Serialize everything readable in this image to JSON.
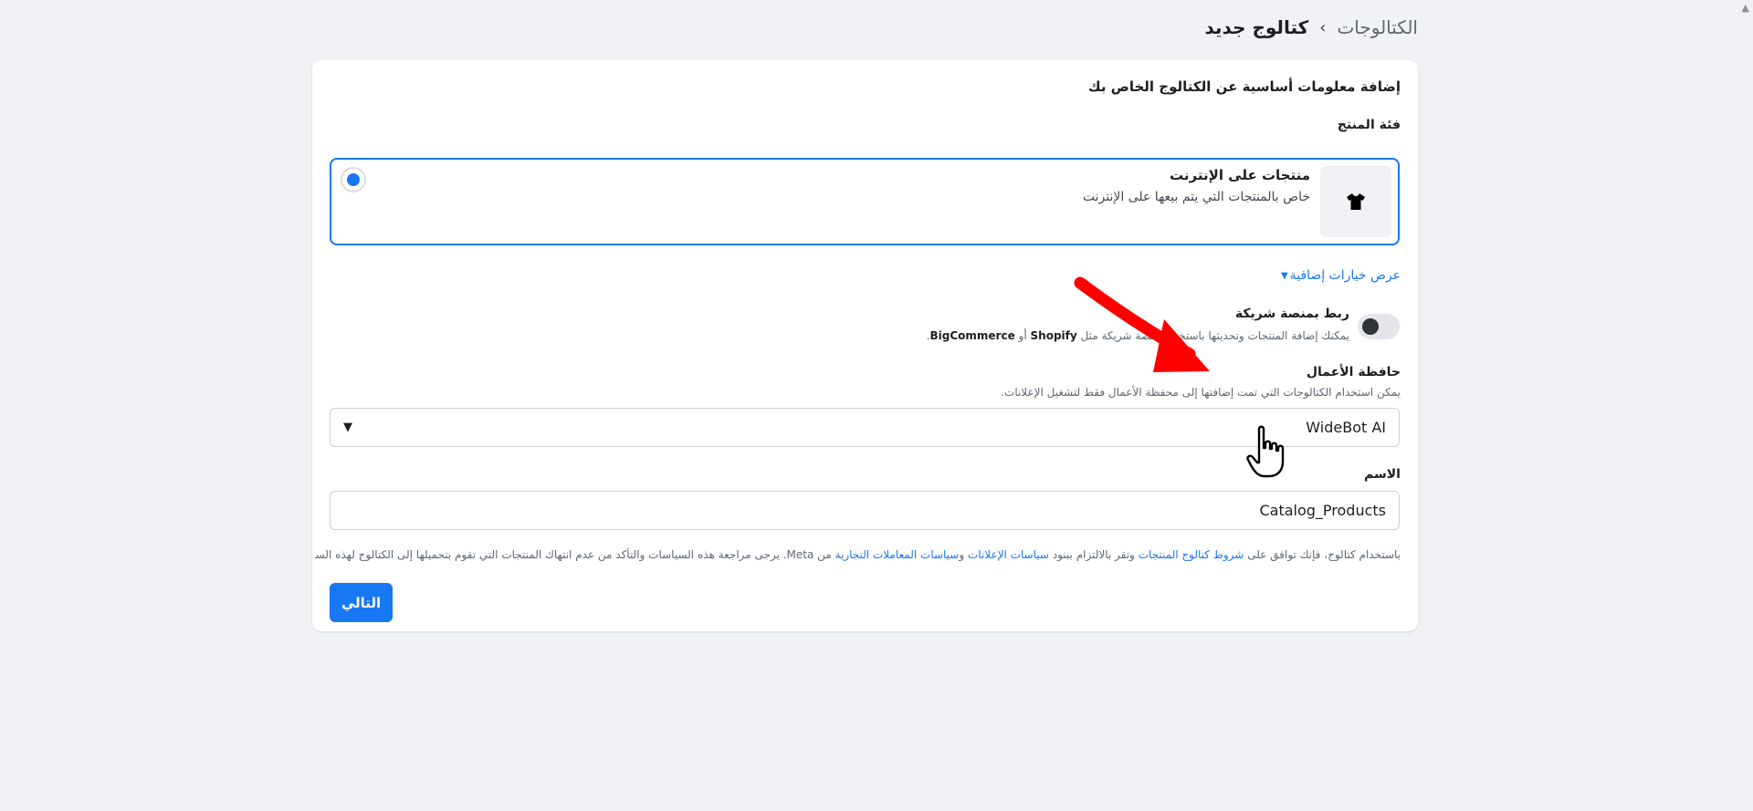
{
  "breadcrumb": {
    "parent": "الكتالوجات",
    "separator": "›",
    "current": "كتالوج جديد"
  },
  "card": {
    "title": "إضافة معلومات أساسية عن الكتالوج الخاص بك",
    "product_category_label": "فئة المنتج",
    "option": {
      "icon": "tshirt-icon",
      "title": "منتجات على الإنترنت",
      "description": "خاص بالمنتجات التي يتم بيعها على الإنترنت",
      "selected": true
    },
    "more_options_label": "عرض خيارات إضافية",
    "partner": {
      "title": "ربط بمنصة شريكة",
      "description_prefix": "يمكنك إضافة المنتجات وتحديثها باستخدام منصة شريكة مثل",
      "shopify": "Shopify",
      "or": "أو",
      "bigcommerce": "BigCommerce",
      "enabled": false
    },
    "business_portfolio": {
      "label": "حافظة الأعمال",
      "description": "يمكن استخدام الكتالوجات التي تمت إضافتها إلى محفظة الأعمال فقط لتشغيل الإعلانات.",
      "value": "WideBot AI"
    },
    "name_field": {
      "label": "الاسم",
      "value": "Catalog_Products"
    },
    "terms": {
      "part1": "باستخدام كتالوج، فإنك توافق على",
      "link1": "شروط كتالوج المنتجات",
      "part2": "وتقر بالالتزام ببنود",
      "link2": "سياسات الإعلانات",
      "and": "و",
      "link3": "سياسات المعاملات التجارية",
      "part3": "من Meta. يرجى مراجعة هذه السياسات والتأكد من عدم انتهاك المنتجات التي تقوم بتحميلها إلى الكتالوج لهذه السياسات."
    },
    "next_label": "التالي"
  },
  "colors": {
    "accent": "#1877f2",
    "background": "#f0f2f5",
    "annotation_arrow": "#ff0000"
  }
}
